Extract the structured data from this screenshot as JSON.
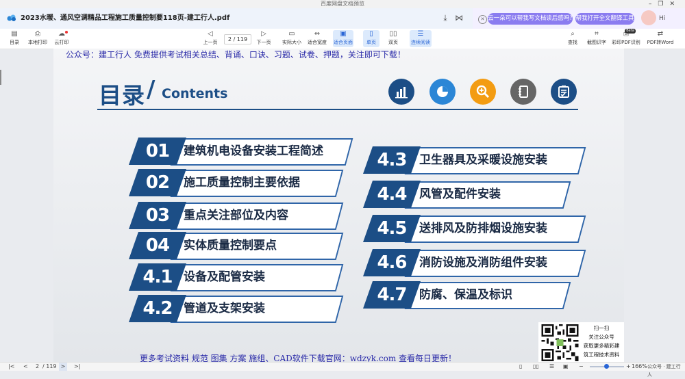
{
  "window": {
    "title": "百度网盘文档预览",
    "controls": [
      "–",
      "❐",
      "✕"
    ]
  },
  "tab": {
    "doc_name": "2023水暖、通风空调精品工程施工质量控制要118页-建工行人.pdf"
  },
  "ai": {
    "suggest_1": "云一朵可以帮我写文档读后感吗?",
    "suggest_2": "帮我打开全文翻译工具",
    "greeting": "Hi"
  },
  "toolbar": {
    "left": [
      "目录",
      "本地打印",
      "云打印"
    ],
    "prev": "上一页",
    "page_current": "2",
    "page_total": "/ 119",
    "next": "下一页",
    "center": [
      "实际大小",
      "适合宽度",
      "适合页面",
      "单页",
      "双页",
      "连续阅读"
    ],
    "right": [
      "查找",
      "截图识字",
      "彩印PDF识别",
      "PDF转Word"
    ],
    "beta": "Beta"
  },
  "document": {
    "promo_top": "公众号：建工行人 免费提供考试相关总结、背诵、口诀、习题、试卷、押题，关注即可下载！",
    "promo_bottom": "更多考试资料 规范 图集 方案 施组、CAD软件下载官网：wdzyk.com 查看每日更新！",
    "heading_cn": "目录",
    "heading_slash": "/",
    "heading_en": "Contents",
    "icons": [
      {
        "name": "bar-chart-icon",
        "color": "#1c4e86"
      },
      {
        "name": "pie-chart-icon",
        "color": "#2b86d6"
      },
      {
        "name": "magnifier-icon",
        "color": "#f39c12"
      },
      {
        "name": "notebook-icon",
        "color": "#666666"
      },
      {
        "name": "checklist-icon",
        "color": "#1c4e86"
      }
    ],
    "toc_left": [
      {
        "num": "01",
        "label": "建筑机电设备安装工程简述"
      },
      {
        "num": "02",
        "label": "施工质量控制主要依据"
      },
      {
        "num": "03",
        "label": "重点关注部位及内容"
      },
      {
        "num": "04",
        "label": "实体质量控制要点"
      },
      {
        "num": "4.1",
        "label": "设备及配管安装"
      },
      {
        "num": "4.2",
        "label": "管道及支架安装"
      }
    ],
    "toc_right": [
      {
        "num": "4.3",
        "label": "卫生器具及采暖设施安装"
      },
      {
        "num": "4.4",
        "label": "风管及配件安装"
      },
      {
        "num": "4.5",
        "label": "送排风及防排烟设施安装"
      },
      {
        "num": "4.6",
        "label": "消防设施及消防组件安装"
      },
      {
        "num": "4.7",
        "label": "防腐、保温及标识"
      }
    ],
    "qr": {
      "line1": "扫一扫",
      "line2": "关注公众号",
      "line3": "获取更多精彩建",
      "line4": "筑工程技术资料"
    }
  },
  "status": {
    "page": "2",
    "total": "/ 119",
    "zoom": "166%",
    "watermark": "公众号 · 建工行人"
  }
}
